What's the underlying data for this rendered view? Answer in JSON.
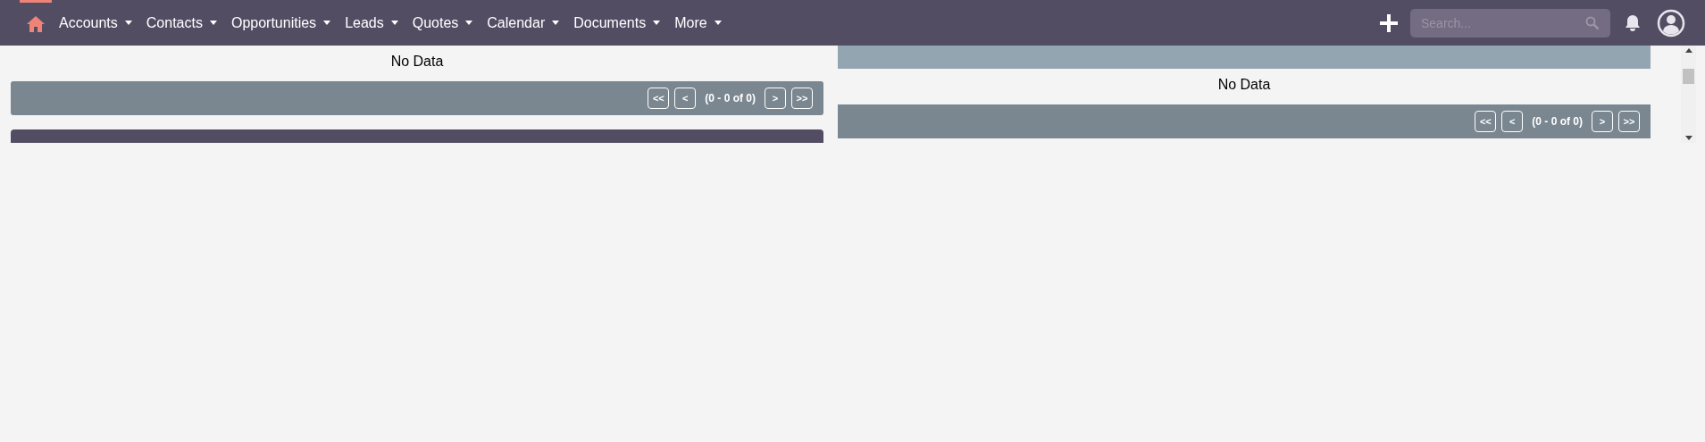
{
  "nav": {
    "items": [
      {
        "label": "Accounts"
      },
      {
        "label": "Contacts"
      },
      {
        "label": "Opportunities"
      },
      {
        "label": "Leads"
      },
      {
        "label": "Quotes"
      },
      {
        "label": "Calendar"
      },
      {
        "label": "Documents"
      },
      {
        "label": "More"
      }
    ],
    "home_selected": true,
    "search": {
      "placeholder": "Search..."
    }
  },
  "dashlets": [
    {
      "header": false,
      "message": "No Data",
      "pager": {
        "first": "<<",
        "prev": "<",
        "range": "(0 - 0 of 0)",
        "next": ">",
        "last": ">>"
      },
      "next_header": true
    },
    {
      "header": true,
      "message": "No Data",
      "pager": {
        "first": "<<",
        "prev": "<",
        "range": "(0 - 0 of 0)",
        "next": ">",
        "last": ">>"
      },
      "next_header": false
    }
  ]
}
